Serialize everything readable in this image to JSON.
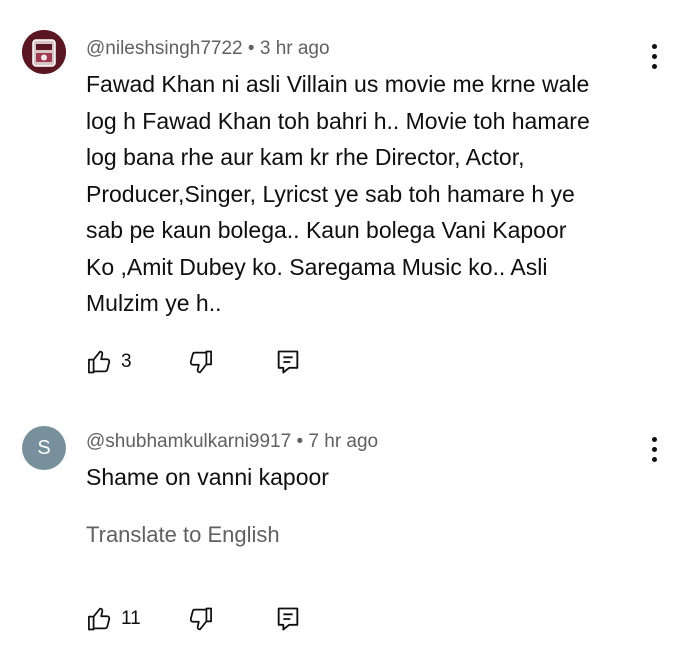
{
  "comments": [
    {
      "username": "@nileshsingh7722",
      "separator": "•",
      "time": "3 hr ago",
      "avatar_icon": "profile-photo",
      "text_lines": [
        "Fawad Khan ni asli Villain us movie me krne wale",
        "log h Fawad Khan toh bahri h.. Movie toh hamare",
        "log bana rhe aur kam kr rhe Director, Actor,",
        "Producer,Singer, Lyricst ye sab toh hamare h ye",
        "sab pe kaun bolega.. Kaun bolega Vani Kapoor",
        "Ko ,Amit Dubey ko. Saregama Music ko.. Asli",
        "Mulzim ye h.."
      ],
      "likes": "3"
    },
    {
      "username": "@shubhamkulkarni9917",
      "separator": "•",
      "time": "7 hr ago",
      "avatar_letter": "S",
      "text": "Shame on vanni kapoor",
      "translate_label": "Translate to English",
      "likes": "11"
    }
  ],
  "icons": {
    "like": "thumb-up-icon",
    "dislike": "thumb-down-icon",
    "reply": "reply-icon",
    "more": "more-vert-icon"
  }
}
